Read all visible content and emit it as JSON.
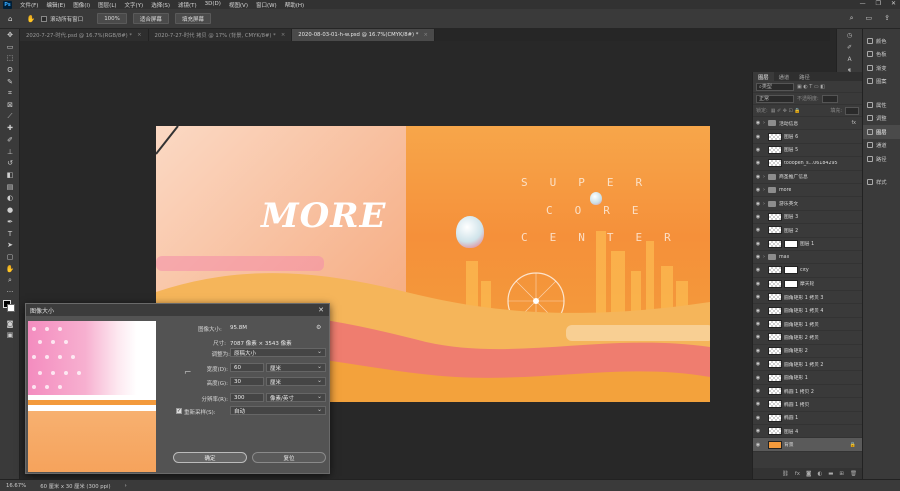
{
  "menubar": {
    "app_icon": "Ps",
    "items": [
      "文件(F)",
      "编辑(E)",
      "图像(I)",
      "图层(L)",
      "文字(Y)",
      "选择(S)",
      "滤镜(T)",
      "3D(D)",
      "视图(V)",
      "窗口(W)",
      "帮助(H)"
    ]
  },
  "options": {
    "scroll_all": "滚动所有窗口",
    "zoom_value": "100%",
    "fit_screen": "适合屏幕",
    "fill_screen": "填充屏幕"
  },
  "tabs": [
    {
      "label": "2020-7-27-时代.psd @ 16.7%(RGB/8#) *",
      "active": false
    },
    {
      "label": "2020-7-27-时代 拷贝 @ 17% (背景, CMYK/8#) *",
      "active": false
    },
    {
      "label": "2020-08-03-01-h-w.psd @ 16.7%(CMYK/8#) *",
      "active": true
    }
  ],
  "artwork": {
    "logo": "MORE",
    "lines": [
      "SUPER",
      "CORE",
      "CENTER"
    ]
  },
  "dialog": {
    "title": "图像大小",
    "image_size_label": "图像大小:",
    "image_size_value": "95.8M",
    "dimensions_label": "尺寸:",
    "dimensions_value": "7087 像素 × 3543 像素",
    "fit_label": "调整为:",
    "fit_value": "原稿大小",
    "width_label": "宽度(D):",
    "width_value": "60",
    "width_unit": "厘米",
    "height_label": "高度(G):",
    "height_value": "30",
    "height_unit": "厘米",
    "resolution_label": "分辨率(R):",
    "resolution_value": "300",
    "resolution_unit": "像素/英寸",
    "resample_label": "重新采样(S):",
    "resample_value": "自动",
    "ok": "确定",
    "cancel": "复位"
  },
  "layers_panel": {
    "tabs": [
      "图层",
      "通道",
      "路径"
    ],
    "kind": "类型",
    "blend": "正常",
    "opacity_label": "不透明度:",
    "lock_label": "锁定:",
    "fill_label": "填充:",
    "layers": [
      {
        "name": "活动信息",
        "type": "folder",
        "fx": true
      },
      {
        "name": "图层 6",
        "type": "layer"
      },
      {
        "name": "图层 5",
        "type": "layer"
      },
      {
        "name": "tooopen_s...06184295",
        "type": "layer"
      },
      {
        "name": "商圣推广信息",
        "type": "folder"
      },
      {
        "name": "more",
        "type": "folder"
      },
      {
        "name": "游乐英文",
        "type": "folder"
      },
      {
        "name": "图层 3",
        "type": "layer"
      },
      {
        "name": "图层 2",
        "type": "layer"
      },
      {
        "name": "图层 1",
        "type": "layer"
      },
      {
        "name": "mall",
        "type": "folder"
      },
      {
        "name": "city",
        "type": "layer"
      },
      {
        "name": "摩天轮",
        "type": "layer"
      },
      {
        "name": "圆角矩形 1 拷贝 3",
        "type": "layer"
      },
      {
        "name": "圆角矩形 1 拷贝 4",
        "type": "layer"
      },
      {
        "name": "圆角矩形 1 拷贝",
        "type": "layer"
      },
      {
        "name": "圆角矩形 2 拷贝",
        "type": "layer"
      },
      {
        "name": "圆角矩形 2",
        "type": "layer"
      },
      {
        "name": "圆角矩形 1 拷贝 2",
        "type": "layer"
      },
      {
        "name": "圆角矩形 1",
        "type": "layer"
      },
      {
        "name": "椭圆 1 拷贝 2",
        "type": "layer"
      },
      {
        "name": "椭圆 1 拷贝",
        "type": "layer"
      },
      {
        "name": "椭圆 1",
        "type": "layer"
      },
      {
        "name": "图层 4",
        "type": "layer"
      },
      {
        "name": "背景",
        "type": "bg"
      }
    ]
  },
  "right_panels": [
    {
      "label": "颜色"
    },
    {
      "label": "色板"
    },
    {
      "label": "渐变"
    },
    {
      "label": "图案"
    },
    {
      "label": "属性"
    },
    {
      "label": "调整"
    },
    {
      "label": "图层"
    },
    {
      "label": "通道"
    },
    {
      "label": "路径"
    },
    {
      "label": "样式"
    }
  ],
  "status": {
    "zoom": "16.67%",
    "doc_size": "60 厘米 x 30 厘米 (300 ppi)"
  }
}
